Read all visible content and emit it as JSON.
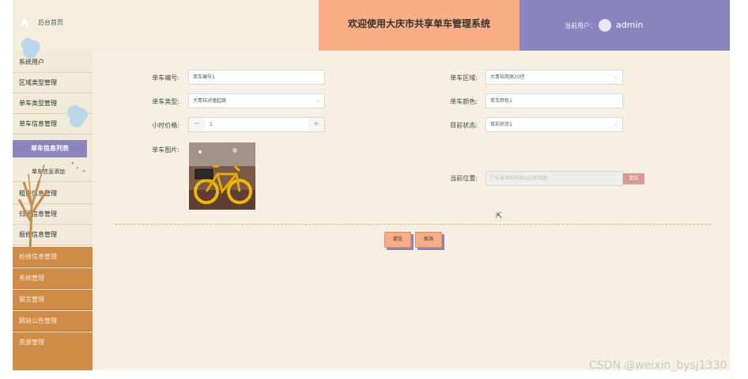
{
  "header": {
    "title": "欢迎使用大庆市共享单车管理系统",
    "current_user_label": "当前用户：",
    "username": "admin"
  },
  "sidebar": {
    "home_label": "后台首页",
    "items": [
      {
        "label": "系统用户"
      },
      {
        "label": "区域类型管理"
      },
      {
        "label": "单车类型管理"
      },
      {
        "label": "单车信息管理"
      },
      {
        "label": "单车信息列表"
      },
      {
        "label": "单车信息添加"
      },
      {
        "label": "租借信息管理"
      },
      {
        "label": "归还信息管理"
      },
      {
        "label": "报修信息管理"
      },
      {
        "label": "检修信息管理"
      },
      {
        "label": "系统管理"
      },
      {
        "label": "留言管理"
      },
      {
        "label": "网站公告管理"
      },
      {
        "label": "资源管理"
      }
    ]
  },
  "form": {
    "bike_no_label": "单车编号:",
    "bike_no_value": "单车编号1",
    "bike_type_label": "单车类型:",
    "bike_type_value": "大青桔对撞起跳",
    "hourly_price_label": "小时价格:",
    "hourly_price_value": "1",
    "bike_photo_label": "单车图片:",
    "region_label": "单车区域:",
    "region_value": "大青桔简原20控",
    "color_label": "单车颜色:",
    "color_value": "单车颜色1",
    "status_label": "目前状态:",
    "status_value": "目前状态1",
    "location_label": "当前位置:",
    "location_placeholder": "广东省深圳市南山区新桃园",
    "locate_button": "定位",
    "stepper_minus": "−",
    "stepper_plus": "+"
  },
  "actions": {
    "submit": "提交",
    "cancel": "取消"
  },
  "watermark": "CSDN @weixin_bysj1330",
  "colors": {
    "accent_orange": "#f8ad84",
    "accent_purple": "#8984bd",
    "sidebar_dark": "#cf8c46",
    "background": "#f7f0e2"
  }
}
